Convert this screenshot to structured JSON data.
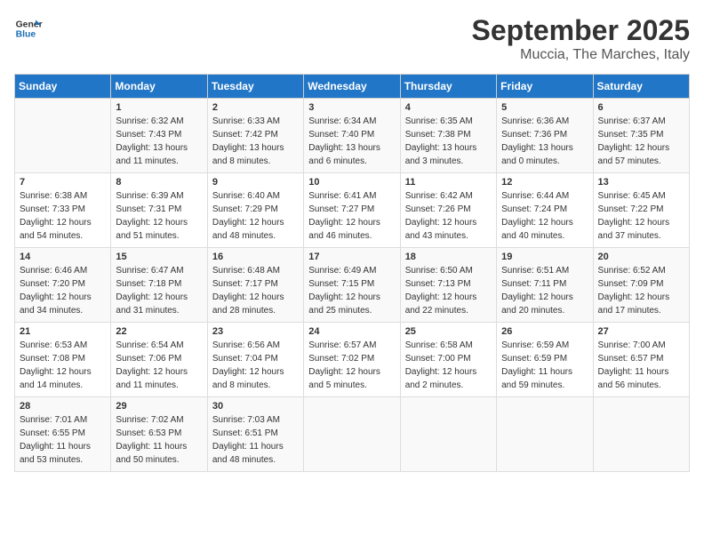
{
  "logo": {
    "text_general": "General",
    "text_blue": "Blue"
  },
  "title": "September 2025",
  "subtitle": "Muccia, The Marches, Italy",
  "headers": [
    "Sunday",
    "Monday",
    "Tuesday",
    "Wednesday",
    "Thursday",
    "Friday",
    "Saturday"
  ],
  "weeks": [
    [
      {
        "day": "",
        "sunrise": "",
        "sunset": "",
        "daylight": ""
      },
      {
        "day": "1",
        "sunrise": "Sunrise: 6:32 AM",
        "sunset": "Sunset: 7:43 PM",
        "daylight": "Daylight: 13 hours and 11 minutes."
      },
      {
        "day": "2",
        "sunrise": "Sunrise: 6:33 AM",
        "sunset": "Sunset: 7:42 PM",
        "daylight": "Daylight: 13 hours and 8 minutes."
      },
      {
        "day": "3",
        "sunrise": "Sunrise: 6:34 AM",
        "sunset": "Sunset: 7:40 PM",
        "daylight": "Daylight: 13 hours and 6 minutes."
      },
      {
        "day": "4",
        "sunrise": "Sunrise: 6:35 AM",
        "sunset": "Sunset: 7:38 PM",
        "daylight": "Daylight: 13 hours and 3 minutes."
      },
      {
        "day": "5",
        "sunrise": "Sunrise: 6:36 AM",
        "sunset": "Sunset: 7:36 PM",
        "daylight": "Daylight: 13 hours and 0 minutes."
      },
      {
        "day": "6",
        "sunrise": "Sunrise: 6:37 AM",
        "sunset": "Sunset: 7:35 PM",
        "daylight": "Daylight: 12 hours and 57 minutes."
      }
    ],
    [
      {
        "day": "7",
        "sunrise": "Sunrise: 6:38 AM",
        "sunset": "Sunset: 7:33 PM",
        "daylight": "Daylight: 12 hours and 54 minutes."
      },
      {
        "day": "8",
        "sunrise": "Sunrise: 6:39 AM",
        "sunset": "Sunset: 7:31 PM",
        "daylight": "Daylight: 12 hours and 51 minutes."
      },
      {
        "day": "9",
        "sunrise": "Sunrise: 6:40 AM",
        "sunset": "Sunset: 7:29 PM",
        "daylight": "Daylight: 12 hours and 48 minutes."
      },
      {
        "day": "10",
        "sunrise": "Sunrise: 6:41 AM",
        "sunset": "Sunset: 7:27 PM",
        "daylight": "Daylight: 12 hours and 46 minutes."
      },
      {
        "day": "11",
        "sunrise": "Sunrise: 6:42 AM",
        "sunset": "Sunset: 7:26 PM",
        "daylight": "Daylight: 12 hours and 43 minutes."
      },
      {
        "day": "12",
        "sunrise": "Sunrise: 6:44 AM",
        "sunset": "Sunset: 7:24 PM",
        "daylight": "Daylight: 12 hours and 40 minutes."
      },
      {
        "day": "13",
        "sunrise": "Sunrise: 6:45 AM",
        "sunset": "Sunset: 7:22 PM",
        "daylight": "Daylight: 12 hours and 37 minutes."
      }
    ],
    [
      {
        "day": "14",
        "sunrise": "Sunrise: 6:46 AM",
        "sunset": "Sunset: 7:20 PM",
        "daylight": "Daylight: 12 hours and 34 minutes."
      },
      {
        "day": "15",
        "sunrise": "Sunrise: 6:47 AM",
        "sunset": "Sunset: 7:18 PM",
        "daylight": "Daylight: 12 hours and 31 minutes."
      },
      {
        "day": "16",
        "sunrise": "Sunrise: 6:48 AM",
        "sunset": "Sunset: 7:17 PM",
        "daylight": "Daylight: 12 hours and 28 minutes."
      },
      {
        "day": "17",
        "sunrise": "Sunrise: 6:49 AM",
        "sunset": "Sunset: 7:15 PM",
        "daylight": "Daylight: 12 hours and 25 minutes."
      },
      {
        "day": "18",
        "sunrise": "Sunrise: 6:50 AM",
        "sunset": "Sunset: 7:13 PM",
        "daylight": "Daylight: 12 hours and 22 minutes."
      },
      {
        "day": "19",
        "sunrise": "Sunrise: 6:51 AM",
        "sunset": "Sunset: 7:11 PM",
        "daylight": "Daylight: 12 hours and 20 minutes."
      },
      {
        "day": "20",
        "sunrise": "Sunrise: 6:52 AM",
        "sunset": "Sunset: 7:09 PM",
        "daylight": "Daylight: 12 hours and 17 minutes."
      }
    ],
    [
      {
        "day": "21",
        "sunrise": "Sunrise: 6:53 AM",
        "sunset": "Sunset: 7:08 PM",
        "daylight": "Daylight: 12 hours and 14 minutes."
      },
      {
        "day": "22",
        "sunrise": "Sunrise: 6:54 AM",
        "sunset": "Sunset: 7:06 PM",
        "daylight": "Daylight: 12 hours and 11 minutes."
      },
      {
        "day": "23",
        "sunrise": "Sunrise: 6:56 AM",
        "sunset": "Sunset: 7:04 PM",
        "daylight": "Daylight: 12 hours and 8 minutes."
      },
      {
        "day": "24",
        "sunrise": "Sunrise: 6:57 AM",
        "sunset": "Sunset: 7:02 PM",
        "daylight": "Daylight: 12 hours and 5 minutes."
      },
      {
        "day": "25",
        "sunrise": "Sunrise: 6:58 AM",
        "sunset": "Sunset: 7:00 PM",
        "daylight": "Daylight: 12 hours and 2 minutes."
      },
      {
        "day": "26",
        "sunrise": "Sunrise: 6:59 AM",
        "sunset": "Sunset: 6:59 PM",
        "daylight": "Daylight: 11 hours and 59 minutes."
      },
      {
        "day": "27",
        "sunrise": "Sunrise: 7:00 AM",
        "sunset": "Sunset: 6:57 PM",
        "daylight": "Daylight: 11 hours and 56 minutes."
      }
    ],
    [
      {
        "day": "28",
        "sunrise": "Sunrise: 7:01 AM",
        "sunset": "Sunset: 6:55 PM",
        "daylight": "Daylight: 11 hours and 53 minutes."
      },
      {
        "day": "29",
        "sunrise": "Sunrise: 7:02 AM",
        "sunset": "Sunset: 6:53 PM",
        "daylight": "Daylight: 11 hours and 50 minutes."
      },
      {
        "day": "30",
        "sunrise": "Sunrise: 7:03 AM",
        "sunset": "Sunset: 6:51 PM",
        "daylight": "Daylight: 11 hours and 48 minutes."
      },
      {
        "day": "",
        "sunrise": "",
        "sunset": "",
        "daylight": ""
      },
      {
        "day": "",
        "sunrise": "",
        "sunset": "",
        "daylight": ""
      },
      {
        "day": "",
        "sunrise": "",
        "sunset": "",
        "daylight": ""
      },
      {
        "day": "",
        "sunrise": "",
        "sunset": "",
        "daylight": ""
      }
    ]
  ]
}
